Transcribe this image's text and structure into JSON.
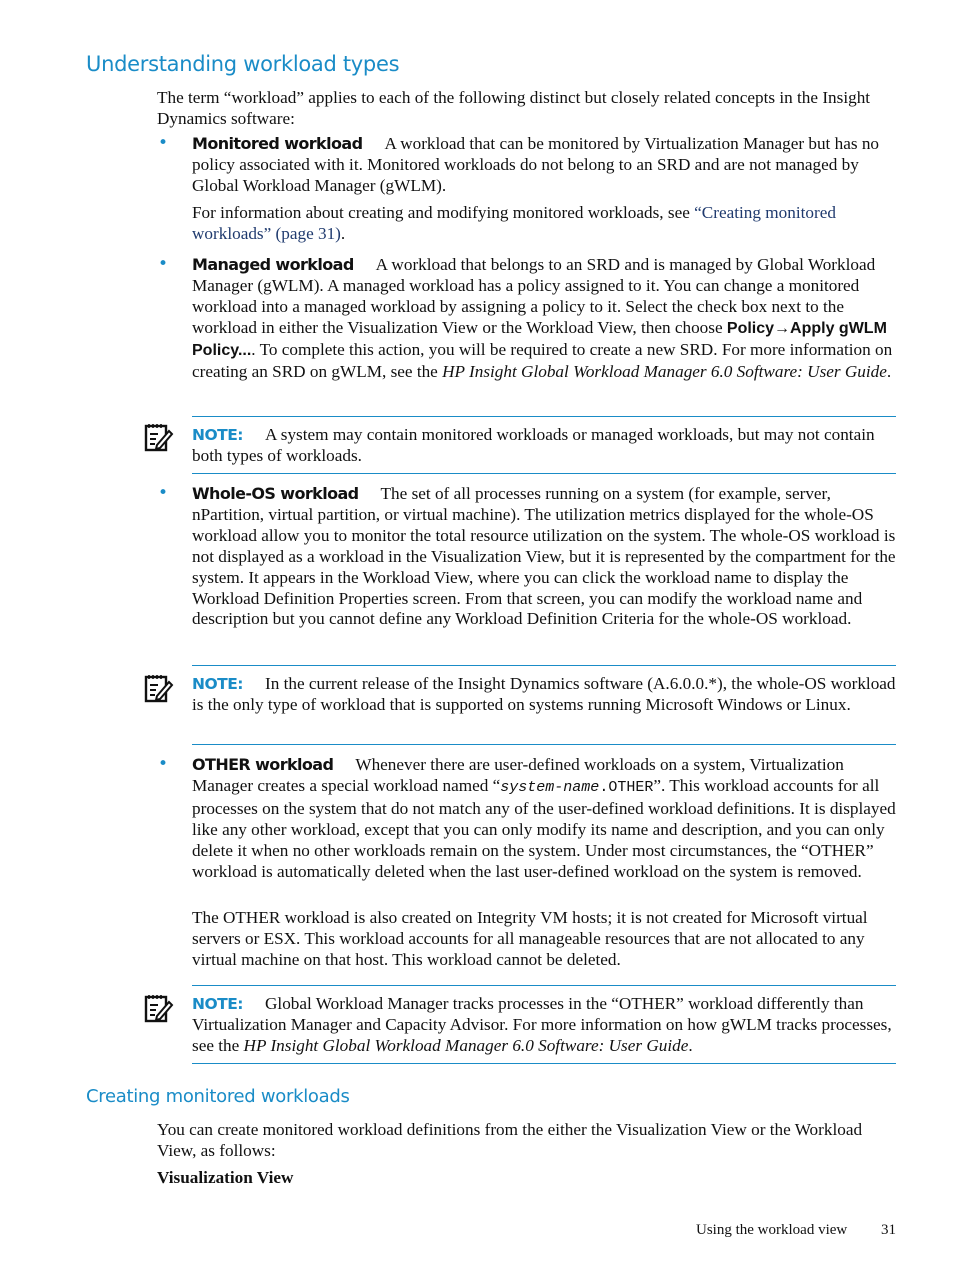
{
  "section1": {
    "title": "Understanding workload types",
    "intro": "The term “workload” applies to each of the following distinct but closely related concepts in the Insight Dynamics software:",
    "items": [
      {
        "term": "Monitored workload",
        "text": "A workload that can be monitored by Virtualization Manager but has no policy associated with it. Monitored workloads do not belong to an SRD and are not managed by Global Workload Manager (gWLM).",
        "extra_prefix": "For information about creating and modifying monitored workloads, see ",
        "extra_link": "“Creating monitored workloads” (page 31)",
        "extra_suffix": "."
      },
      {
        "term": "Managed workload",
        "text_a": "A workload that belongs to an SRD and is managed by Global Workload Manager (gWLM). A managed workload has a policy assigned to it. You can change a monitored workload into a managed workload by assigning a policy to it. Select the check box next to the workload in either the Visualization View or the Workload View, then choose ",
        "menu_path": "Policy→Apply gWLM Policy...",
        "text_b": ". To complete this action, you will be required to create a new SRD. For more information on creating an SRD on gWLM, see the ",
        "ref": "HP Insight Global Workload Manager 6.0 Software: User Guide",
        "text_c": "."
      },
      {
        "term": "Whole-OS workload",
        "text": "The set of all processes running on a system (for example, server, nPartition, virtual partition, or virtual machine). The utilization metrics displayed for the whole-OS workload allow you to monitor the total resource utilization on the system. The whole-OS workload is not displayed as a workload in the Visualization View, but it is represented by the compartment for the system. It appears in the Workload View, where you can click the workload name to display the Workload Definition Properties screen. From that screen, you can modify the workload name and description but you cannot define any Workload Definition Criteria for the whole-OS workload."
      },
      {
        "term": "OTHER workload",
        "text_a": "Whenever there are user-defined workloads on a system, Virtualization Manager creates a special workload named “",
        "code_italic": "system-name",
        "code_plain": ".OTHER",
        "text_b": "”. This workload accounts for all processes on the system that do not match any of the user-defined workload definitions. It is displayed like any other workload, except that you can only modify its name and description, and you can only delete it when no other workloads remain on the system. Under most circumstances, the “OTHER” workload is automatically deleted when the last user-defined workload on the system is removed.",
        "extra": "The OTHER workload is also created on Integrity VM hosts; it is not created for Microsoft virtual servers or ESX. This workload accounts for all manageable resources that are not allocated to any virtual machine on that host. This workload cannot be deleted."
      }
    ],
    "notes": [
      {
        "label": "NOTE:",
        "text": "A system may contain monitored workloads or managed workloads, but may not contain both types of workloads."
      },
      {
        "label": "NOTE:",
        "text": "In the current release of the Insight Dynamics software (A.6.0.0.*), the whole-OS workload is the only type of workload that is supported on systems running Microsoft Windows or Linux."
      },
      {
        "label": "NOTE:",
        "text_a": "Global Workload Manager tracks processes in the “OTHER” workload differently than Virtualization Manager and Capacity Advisor. For more information on how gWLM tracks processes, see the ",
        "ref": "HP Insight Global Workload Manager 6.0 Software: User Guide",
        "text_b": "."
      }
    ]
  },
  "section2": {
    "title": "Creating monitored workloads",
    "intro": "You can create monitored workload definitions from the either the Visualization View or the Workload View, as follows:",
    "subheading": "Visualization View"
  },
  "footer": {
    "chapter": "Using the workload view",
    "page": "31"
  },
  "colors": {
    "heading": "#1a8cc7",
    "link": "#1f3a6e",
    "rule": "#1a8cc7"
  }
}
